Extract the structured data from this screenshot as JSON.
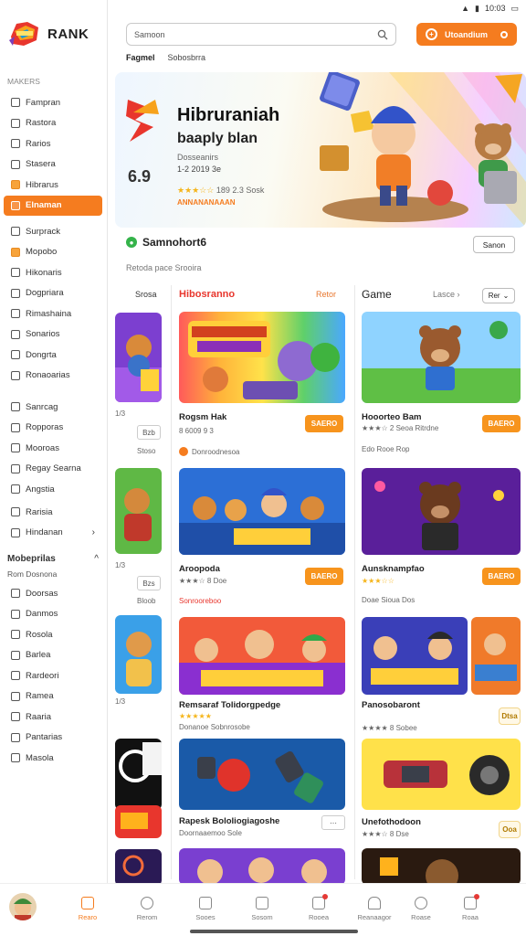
{
  "status": {
    "time": "10:03",
    "wifi": "wifi-icon",
    "signal": "signal-icon",
    "battery": "battery-icon"
  },
  "app": {
    "name": "RANK"
  },
  "sidebar": {
    "section_label": "MAKERS",
    "items": [
      {
        "label": "Fampran",
        "icon": "home-icon"
      },
      {
        "label": "Rastora",
        "icon": "chart-icon"
      },
      {
        "label": "Rarios",
        "icon": "lock-icon"
      },
      {
        "label": "Stasera",
        "icon": "box-icon"
      },
      {
        "label": "Hibrarus",
        "icon": "star-icon",
        "highlight": true
      },
      {
        "label": "Elnaman",
        "icon": "flame-icon",
        "active": true
      },
      {
        "label": "Surprack",
        "icon": "tag-icon"
      },
      {
        "label": "Mopobo",
        "icon": "gift-icon",
        "highlight": true
      },
      {
        "label": "Hikonaris",
        "icon": "square-icon"
      },
      {
        "label": "Dogpriara",
        "icon": "grid-icon"
      },
      {
        "label": "Rimashaina",
        "icon": "bookmark-icon"
      },
      {
        "label": "Sonarios",
        "icon": "pen-icon"
      },
      {
        "label": "Dongrta",
        "icon": "mail-icon"
      },
      {
        "label": "Ronaoarias",
        "icon": "layers-icon"
      },
      {
        "label": "Sanrcag",
        "icon": "calendar-icon"
      },
      {
        "label": "Ropporas",
        "icon": "clock-icon"
      },
      {
        "label": "Mooroas",
        "icon": "folder-icon"
      },
      {
        "label": "Regay Searna",
        "icon": "bell-icon"
      },
      {
        "label": "Angstia",
        "icon": "flag-icon"
      },
      {
        "label": "Rarisia",
        "icon": "cup-icon"
      },
      {
        "label": "Hindanan",
        "icon": "list-icon",
        "chevron": "›"
      }
    ],
    "sub_section": {
      "title": "Mobeprilas",
      "caption": "Rom Dosnona",
      "chevron": "^"
    },
    "sub_items": [
      {
        "label": "Doorsas",
        "icon": "doc-icon"
      },
      {
        "label": "Danmos",
        "icon": "doc-icon"
      },
      {
        "label": "Rosola",
        "icon": "doc-icon"
      },
      {
        "label": "Barlea",
        "icon": "doc-icon"
      },
      {
        "label": "Rardeori",
        "icon": "doc-icon"
      },
      {
        "label": "Ramea",
        "icon": "doc-icon"
      },
      {
        "label": "Raaria",
        "icon": "pen-icon"
      },
      {
        "label": "Pantarias",
        "icon": "doc-icon"
      },
      {
        "label": "Masola",
        "icon": "doc-icon"
      }
    ]
  },
  "header": {
    "search_placeholder": "Samoon",
    "cta_label": "Utoandium"
  },
  "breadcrumb": {
    "first": "Fagmel",
    "second": "Sobosbrra"
  },
  "hero": {
    "title": "Hibruraniah",
    "subtitle": "baaply blan",
    "category": "Dosseanirs",
    "date": "1-2 2019 3e",
    "rating": "6.9",
    "stars": "★★★☆☆",
    "rating_text": "189 2.3 Sosk",
    "tag": "ANNANANAAAN"
  },
  "spotlight": {
    "title": "Samnohort6",
    "button": "Sanon",
    "subtitle": "Retoda pace Srooira"
  },
  "columns": {
    "left_header": "Srosa",
    "mid_header": "Hibosranno",
    "mid_link": "Retor",
    "right_header": "Game",
    "right_link": "Lasce",
    "right_select": "Rer"
  },
  "left_col": {
    "r1": {
      "meta": "1/3",
      "btn": "Bzb",
      "sub": "Stoso"
    },
    "r2": {
      "meta": "1/3",
      "btn": "Bzs",
      "sub": "Bloob"
    },
    "r3": {
      "meta": "1/3"
    }
  },
  "mid_col": [
    {
      "title": "Rogsm Hak",
      "meta": "8 6009 9 3",
      "btn": "SAERO",
      "footer": "Donroodnesoa"
    },
    {
      "title": "Aroopoda",
      "meta": "★★★☆ 8 Doe",
      "btn": "BAERO",
      "footer": "Sonrooreboo"
    },
    {
      "title": "Remsaraf Tolidorgpedge",
      "meta": "★★★★★",
      "sub": "Donanoe Sobnrosobe"
    },
    {
      "title": "Rapesk Bololiogiagoshe",
      "meta": "Doornaaemoo Sole"
    }
  ],
  "right_col": [
    {
      "title": "Hooorteo Bam",
      "meta": "★★★☆ 2 Seoa Ritrdne",
      "btn": "BAERO",
      "footer": "Edo Rooe Rop"
    },
    {
      "title": "Aunsknampfao",
      "meta": "★★★☆☆",
      "btn": "BAERO",
      "footer": "Doae Sioua Dos"
    },
    {
      "title": "Panosobaront",
      "meta": "★★★★ 8 Sobee",
      "btn": "Dtsa"
    },
    {
      "title": "Unefothodoon",
      "meta": "★★★☆ 8 Dse",
      "btn": "Ooa"
    }
  ],
  "bottom_nav": [
    {
      "label": "Rearo",
      "icon": "home-icon",
      "active": true
    },
    {
      "label": "Rerom",
      "icon": "search-icon"
    },
    {
      "label": "Sooes",
      "icon": "doc-icon"
    },
    {
      "label": "Sosom",
      "icon": "chat-icon"
    },
    {
      "label": "Rooea",
      "icon": "download-icon",
      "badge": true
    },
    {
      "label": "Reanaagor",
      "icon": "bell-icon"
    },
    {
      "label": "Roase",
      "icon": "settings-icon"
    },
    {
      "label": "Roaa",
      "icon": "profile-icon",
      "badge": true
    }
  ],
  "colors": {
    "accent": "#f57c1f",
    "star": "#f5b51b"
  }
}
